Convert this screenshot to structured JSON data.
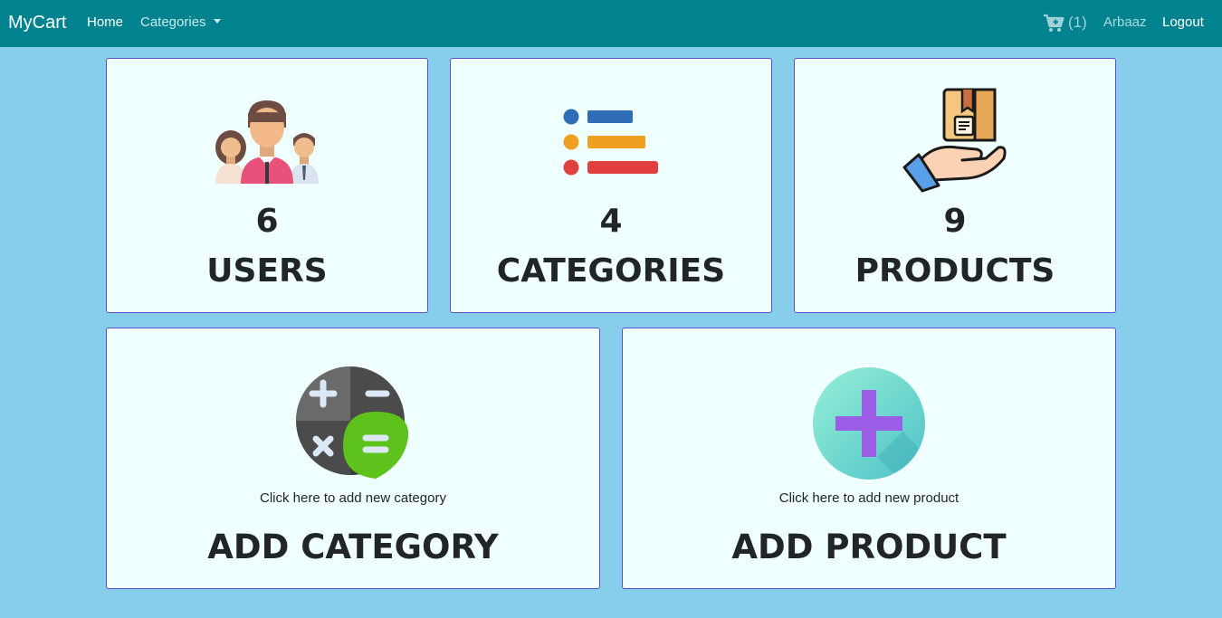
{
  "navbar": {
    "brand": "MyCart",
    "home_label": "Home",
    "categories_label": "Categories",
    "cart_count": "(1)",
    "user_name": "Arbaaz",
    "logout_label": "Logout"
  },
  "stats": {
    "users": {
      "count": "6",
      "label": "USERS",
      "icon": "users-icon"
    },
    "categories": {
      "count": "4",
      "label": "CATEGORIES",
      "icon": "list-icon"
    },
    "products": {
      "count": "9",
      "label": "PRODUCTS",
      "icon": "product-hand-icon"
    }
  },
  "actions": {
    "add_category": {
      "description": "Click here to add new category",
      "label": "ADD CATEGORY",
      "icon": "calculator-icon"
    },
    "add_product": {
      "description": "Click here to add new product",
      "label": "ADD PRODUCT",
      "icon": "plus-circle-icon"
    }
  },
  "colors": {
    "navbar": "#00838f",
    "background": "#87ceeb",
    "card": "#f0ffff",
    "card_border": "#5b4fcf"
  }
}
